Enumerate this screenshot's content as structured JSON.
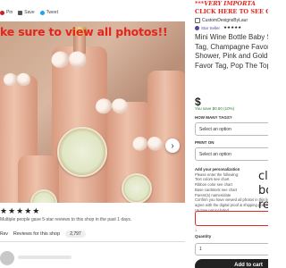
{
  "share": {
    "pin": "Pin",
    "save": "Save",
    "tweet": "Tweet"
  },
  "photo": {
    "banner": "ke sure to view all photos!!",
    "next_icon": "chevron-right-icon"
  },
  "reviews": {
    "stars": "★★★★★",
    "note": "Multiple people gave 5-star reviews to this shop in the past 1 days.",
    "tab_label": "Reviews for this shop",
    "tab_count": "2,797",
    "tab_item": "Rev"
  },
  "right": {
    "promo": "***VERY IMPORTA",
    "promo_link": "CLICK HERE TO SEE OUR SI",
    "shop_name": "CustomDesignsByLaur",
    "star_seller": "Star Seller",
    "rating_stars": "★★★★★",
    "title_lines": [
      "Mini Wine Bottle Baby Sh",
      "Tag, Champagne Favor Ta",
      "Shower, Pink and Gold, Pe",
      "Favor Tag, Pop The Top a"
    ],
    "price": "$",
    "save_note": "You save $0.50 (10%)",
    "tags_label": "HOW MANY TAGS?",
    "tags_select": "Select an option",
    "print_label": "PRINT ON",
    "print_select": "Select an option",
    "perso_lines": [
      "Add your personalization",
      "Please enter the following:",
      "Text colors see chart",
      "Ribbon color see chart",
      "Base cardstock see chart",
      "Parent(s) names/date",
      "Confirm you have viewed all photos in this listing and",
      "agree with the digital proof & shipping policies",
      "Up bow not included"
    ],
    "perso_count": "1",
    "qty_label": "Quantity",
    "qty_value": "1",
    "cart_label": "Add to cart"
  },
  "overlay": {
    "line1": "cli",
    "line2": "bo",
    "line3": "re"
  },
  "colors": {
    "accent_red": "#e5241e",
    "star_seller": "#5a3ea6"
  }
}
